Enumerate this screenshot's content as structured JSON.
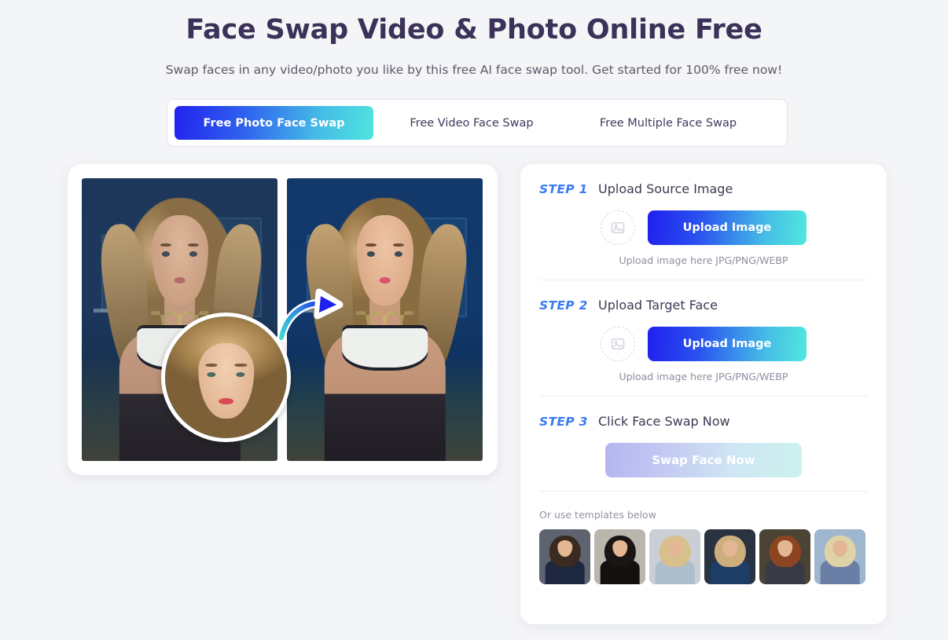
{
  "header": {
    "title": "Face Swap Video & Photo Online Free",
    "subtitle": "Swap faces in any video/photo you like by this free AI face swap tool. Get started for 100% free now!"
  },
  "tabs": [
    {
      "label": "Free Photo Face Swap",
      "active": true
    },
    {
      "label": "Free Video Face Swap",
      "active": false
    },
    {
      "label": "Free Multiple Face Swap",
      "active": false
    }
  ],
  "preview": {
    "before_label": "before-face-swap-photo",
    "after_label": "after-face-swap-photo",
    "inset_label": "source-face-thumbnail",
    "arrow_label": "swap-direction-arrow"
  },
  "steps": [
    {
      "number": "STEP 1",
      "title": "Upload Source Image",
      "button_label": "Upload Image",
      "hint": "Upload image here JPG/PNG/WEBP",
      "icon": "image-placeholder-icon"
    },
    {
      "number": "STEP 2",
      "title": "Upload Target Face",
      "button_label": "Upload Image",
      "hint": "Upload image here JPG/PNG/WEBP",
      "icon": "image-placeholder-icon"
    },
    {
      "number": "STEP 3",
      "title": "Click Face Swap Now",
      "button_label": "Swap Face Now",
      "disabled": true
    }
  ],
  "templates": {
    "label": "Or use templates below",
    "items": [
      {
        "name": "template-woman-navy-sweater",
        "bg": "#5e6370",
        "hair": "#3a2b22",
        "body": "#1d2740"
      },
      {
        "name": "template-woman-black-dress",
        "bg": "#b9b6ae",
        "hair": "#1a1413",
        "body": "#14100f"
      },
      {
        "name": "template-woman-blonde-blue-dress",
        "bg": "#c9cfd4",
        "hair": "#d8c08c",
        "body": "#aebecb"
      },
      {
        "name": "template-captain-america",
        "bg": "#2a3340",
        "hair": "#cdae7d",
        "body": "#1d3d66"
      },
      {
        "name": "template-warrior-redhead",
        "bg": "#4b4334",
        "hair": "#8d4521",
        "body": "#3a3a46"
      },
      {
        "name": "template-blond-man-football",
        "bg": "#9fb6cf",
        "hair": "#ddd3a6",
        "body": "#6b7fa6"
      }
    ]
  },
  "colors": {
    "accent_blue": "#3b7bf0",
    "gradient_start": "#2020ee",
    "gradient_end": "#51e8de",
    "page_bg": "#f4f5f7",
    "title_color": "#3b3159"
  }
}
